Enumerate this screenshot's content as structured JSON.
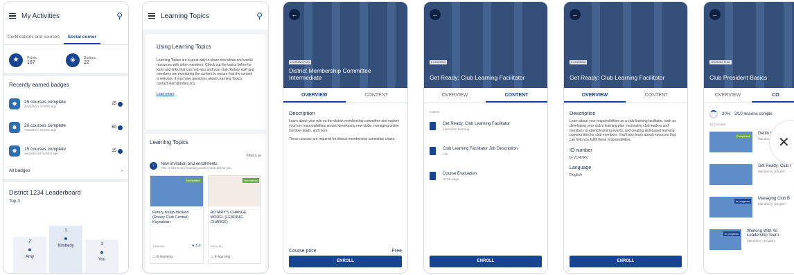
{
  "s1": {
    "title": "My Activities",
    "tabs": [
      "Certifications and courses",
      "Social corner"
    ],
    "points_label": "Points",
    "points": "167",
    "badges_label": "Badges",
    "badges": "22",
    "recent_heading": "Recently earned badges",
    "badges_list": [
      {
        "title": "25 courses complete",
        "sub": "Awarded 2 months ago",
        "count": "25"
      },
      {
        "title": "20 courses complete",
        "sub": "Awarded 7 months ago",
        "count": "80"
      },
      {
        "title": "15 courses complete",
        "sub": "Awarded 10 months ago",
        "count": "15"
      }
    ],
    "all_badges": "All badges",
    "leaderboard": "District 1234 Leaderboard",
    "top": "Top 3",
    "podium": [
      {
        "rank": "2",
        "name": "Amy"
      },
      {
        "rank": "1",
        "name": "Kimberly"
      },
      {
        "rank": "3",
        "name": "You"
      }
    ]
  },
  "s2": {
    "title": "Learning Topics",
    "card_title": "Using Learning Topics",
    "card_text": "Learning Topics are a great way to share new ideas and useful resources with other members. Check out the topics below for tools and links that can help you and your club. Rotary staff and members are monitoring the content to ensure that the content is relevant. If you have questions about Learning Topics, contact learn@rotary.org.",
    "learn_more": "Learn more",
    "section": "Learning Topics",
    "filters": "Filters",
    "inv_title": "New invitation and enrollments",
    "inv_sub": "This is all the new learning content selected for you",
    "cards": [
      {
        "tag": "Not started",
        "title": "Rotary Kulüp Merkezi (Rotary Club Central) Kaynakları",
        "lang": "TURKISH",
        "rating": "5.0",
        "type": "E-learning"
      },
      {
        "tag": "Not started",
        "title": "ROTARY'S CHANGE MODEL (LEADING CHANGE)",
        "lang": "ENGLISH",
        "rating": "",
        "type": "E-learning"
      }
    ]
  },
  "s3": {
    "tag": "LEARNING PLAN",
    "title": "District Membership Committee Intermediate",
    "tabs": [
      "OVERVIEW",
      "CONTENT"
    ],
    "desc_h": "Description",
    "desc1": "Learn about your role on the district membership committee and explore your key responsibilities around developing new clubs, managing online member leads, and more.",
    "desc2": "These courses are required for district membership committee chairs.",
    "price_label": "Course price",
    "price": "Free",
    "enroll": "ENROLL"
  },
  "s4": {
    "tag": "E-LEARNING",
    "title": "Get Ready:  Club Learning Facilitator",
    "tabs": [
      "OVERVIEW",
      "CONTENT"
    ],
    "items_count": "3 items",
    "items": [
      {
        "title": "Get Ready: Club Learning Facilitator",
        "sub": "Interactive learning"
      },
      {
        "title": "Club Learning Facilitator Job Description",
        "sub": "File"
      },
      {
        "title": "Course Evaluation",
        "sub": "HTML page"
      }
    ],
    "enroll": "ENROLL"
  },
  "s5": {
    "tag": "E-LEARNING",
    "title": "Get Ready:  Club Learning Facilitator",
    "tabs": [
      "OVERVIEW",
      "CONTENT"
    ],
    "desc_h": "Description",
    "desc": "Learn about your responsibilities as a club learning facilitator, such as developing your club's learning plan, motivating club leaders and members to attend learning events, and creating skill-based learning opportunities for club members. You'll also learn about resources that can help you fulfill these responsibilities.",
    "id_label": "ID number",
    "id": "E-VO47RV",
    "lang_label": "Language",
    "lang": "English",
    "enroll": "ENROLL"
  },
  "s6": {
    "tag": "LEARNING PLAN",
    "title": "Club President Basics",
    "tabs": [
      "OVERVIEW",
      "CO"
    ],
    "progress": "20%",
    "progress_text": "2/10 lessons comple",
    "count": "10 Courses",
    "rows": [
      {
        "tag": "Completed",
        "title": "Gettin Learnin",
        "sub": "Mandatory"
      },
      {
        "tag": "",
        "title": "Get Ready: Club I",
        "sub": "Mandatory | English"
      },
      {
        "tag": "In progress",
        "title": "Managing Club B",
        "sub": "Mandatory | English"
      },
      {
        "tag": "In progress",
        "title": "Working With Yo Leadership Team",
        "sub": "Mandatory | English"
      }
    ]
  },
  "colors": {
    "primary": "#17458f",
    "hero": "#34507a",
    "tag_green": "#6aa84f"
  }
}
